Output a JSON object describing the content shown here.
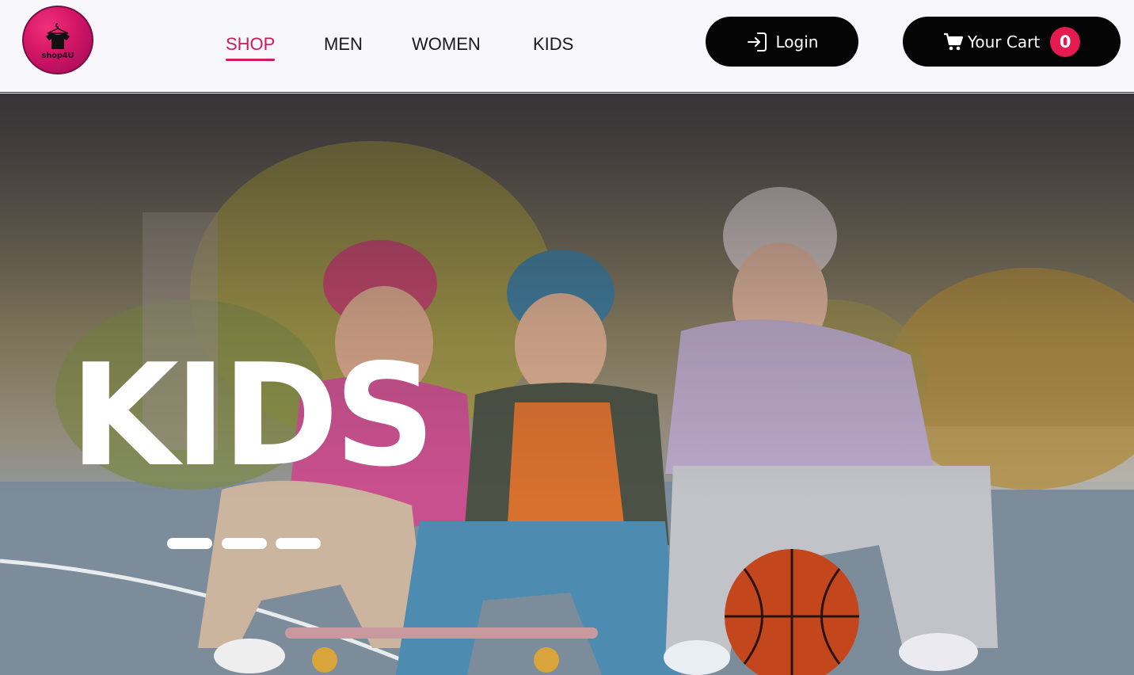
{
  "brand": {
    "logo_text": "shop4U"
  },
  "nav": {
    "items": [
      {
        "label": "SHOP",
        "active": true
      },
      {
        "label": "MEN",
        "active": false
      },
      {
        "label": "WOMEN",
        "active": false
      },
      {
        "label": "KIDS",
        "active": false
      }
    ]
  },
  "actions": {
    "login_label": "Login",
    "cart_label": "Your Cart",
    "cart_count": "0"
  },
  "hero": {
    "title": "KIDS"
  },
  "colors": {
    "accent": "#d11a58",
    "badge": "#e51a4e",
    "button": "#050505",
    "header_bg": "#f7f7fc"
  }
}
